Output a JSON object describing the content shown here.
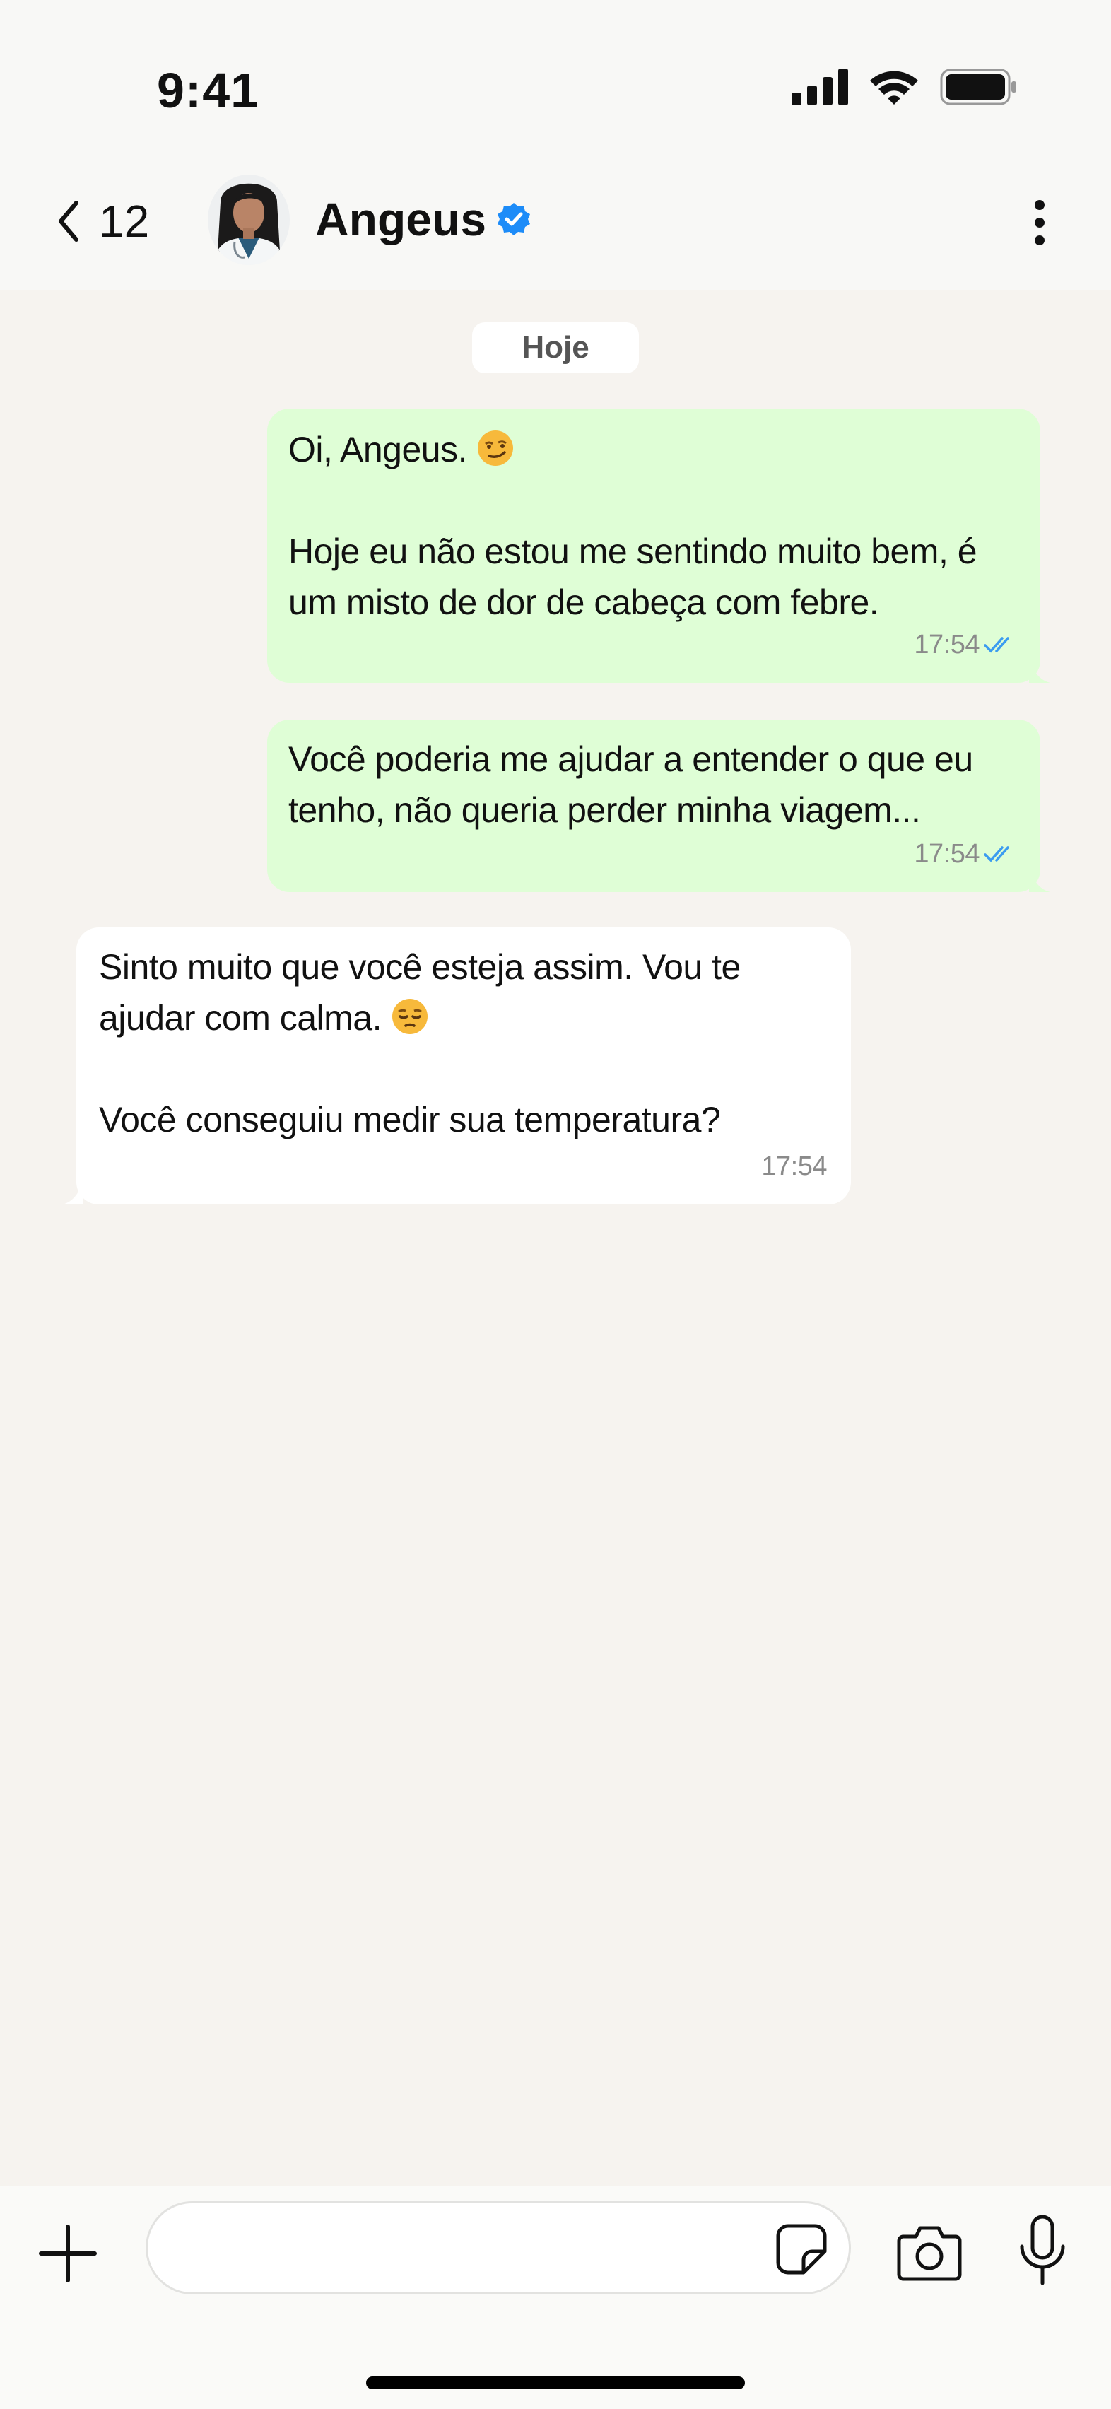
{
  "status_bar": {
    "time": "9:41"
  },
  "header": {
    "back_count": "12",
    "contact_name": "Angeus"
  },
  "chat": {
    "date_label": "Hoje",
    "messages": [
      {
        "direction": "outgoing",
        "paragraphs": [
          "Oi, Angeus.",
          "Hoje eu não estou me sentindo muito bem, é um misto de dor de cabeça com febre."
        ],
        "emoji": "smirk-face-icon",
        "time": "17:54",
        "status": "read"
      },
      {
        "direction": "outgoing",
        "paragraphs": [
          "Você poderia me ajudar a entender o que eu tenho, não queria perder minha viagem..."
        ],
        "time": "17:54",
        "status": "read"
      },
      {
        "direction": "incoming",
        "paragraphs": [
          "Sinto muito que você esteja assim. Vou te ajudar com calma.",
          "Você conseguiu medir sua temperatura?"
        ],
        "emoji": "pensive-face-icon",
        "time": "17:54"
      }
    ]
  },
  "input": {
    "placeholder": ""
  },
  "colors": {
    "outgoing_bubble": "#dffed6",
    "incoming_bubble": "#ffffff",
    "background": "#f6f3ef",
    "verified": "#1d8cf8",
    "read_ticks": "#3b9cf0"
  }
}
